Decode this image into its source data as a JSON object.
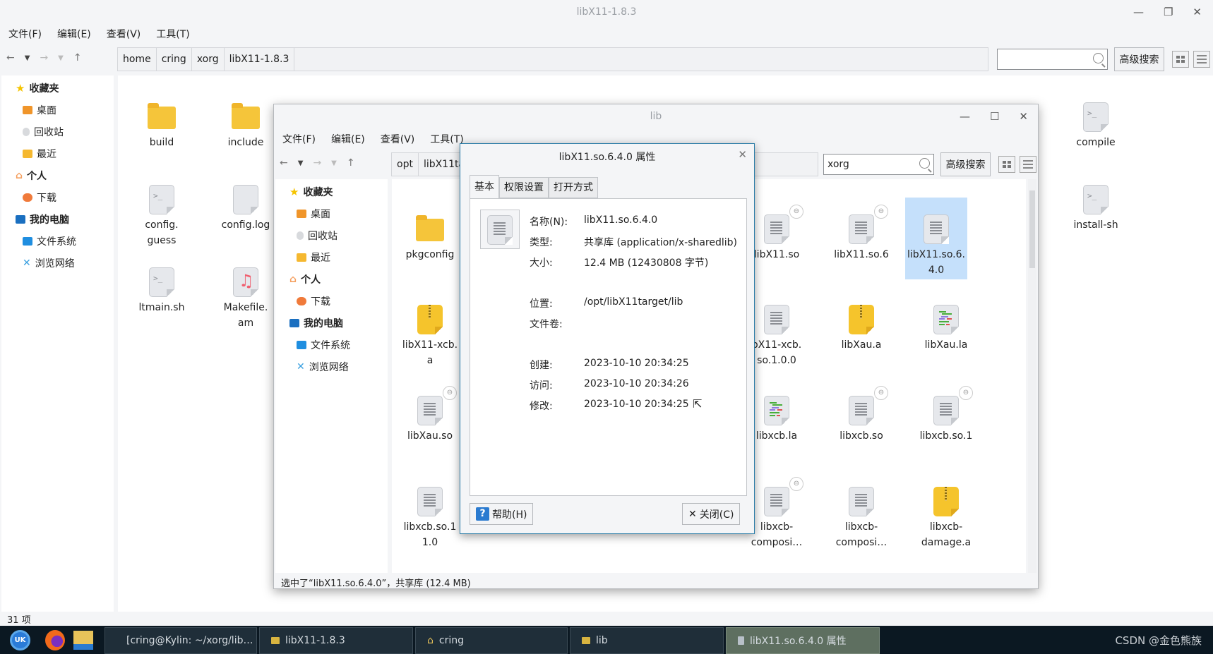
{
  "main_window": {
    "title": "libX11-1.8.3",
    "menu": [
      "文件(F)",
      "编辑(E)",
      "查看(V)",
      "工具(T)"
    ],
    "breadcrumbs": [
      "home",
      "cring",
      "xorg",
      "libX11-1.8.3"
    ],
    "search_value": "",
    "advanced_search_label": "高级搜索",
    "sidebar": [
      {
        "label": "收藏夹",
        "header": true,
        "icon": "star-icon"
      },
      {
        "label": "桌面",
        "icon": "desktop-icon"
      },
      {
        "label": "回收站",
        "icon": "trash-icon"
      },
      {
        "label": "最近",
        "icon": "recent-icon"
      },
      {
        "label": "个人",
        "header": true,
        "icon": "home-icon"
      },
      {
        "label": "下载",
        "icon": "download-icon"
      },
      {
        "label": "我的电脑",
        "header": true,
        "icon": "computer-icon"
      },
      {
        "label": "文件系统",
        "icon": "drive-icon"
      },
      {
        "label": "浏览网络",
        "icon": "network-icon"
      }
    ],
    "files": [
      {
        "name": "build",
        "type": "folder"
      },
      {
        "name": "include",
        "type": "folder"
      },
      {
        "name": "compile",
        "type": "script"
      },
      {
        "name": "config.\nguess",
        "type": "script"
      },
      {
        "name": "config.log",
        "type": "doc"
      },
      {
        "name": "install-sh",
        "type": "script"
      },
      {
        "name": "ltmain.sh",
        "type": "script"
      },
      {
        "name": "Makefile.\nam",
        "type": "music"
      }
    ],
    "status": "31 项"
  },
  "lib_window": {
    "title": "lib",
    "menu": [
      "文件(F)",
      "编辑(E)",
      "查看(V)",
      "工具(T)"
    ],
    "breadcrumbs": [
      "opt",
      "libX11ta"
    ],
    "search_value": "xorg",
    "advanced_search_label": "高级搜索",
    "sidebar": [
      {
        "label": "收藏夹",
        "header": true
      },
      {
        "label": "桌面"
      },
      {
        "label": "回收站"
      },
      {
        "label": "最近"
      },
      {
        "label": "个人",
        "header": true
      },
      {
        "label": "下载"
      },
      {
        "label": "我的电脑",
        "header": true
      },
      {
        "label": "文件系统"
      },
      {
        "label": "浏览网络"
      }
    ],
    "files": [
      {
        "name": "pkgconfig",
        "type": "folder"
      },
      {
        "name": "libX11.so",
        "type": "doc",
        "link": true
      },
      {
        "name": "libX11.so.6",
        "type": "doc",
        "link": true
      },
      {
        "name": "libX11.so.6.\n4.0",
        "type": "doc",
        "selected": true
      },
      {
        "name": "libX11-xcb.\na",
        "type": "zip"
      },
      {
        "name": "bX11-xcb.\nso.1.0.0",
        "type": "doc"
      },
      {
        "name": "libXau.a",
        "type": "zip"
      },
      {
        "name": "libXau.la",
        "type": "code"
      },
      {
        "name": "libXau.so",
        "type": "doc",
        "link": true
      },
      {
        "name": "libxcb.la",
        "type": "code"
      },
      {
        "name": "libxcb.so",
        "type": "doc",
        "link": true
      },
      {
        "name": "libxcb.so.1",
        "type": "doc",
        "link": true
      },
      {
        "name": "libxcb.so.1\n1.0",
        "type": "doc"
      },
      {
        "name": "composi…",
        "type": "hidden"
      },
      {
        "name": "composi…",
        "type": "hidden"
      },
      {
        "name": "composi…",
        "type": "hidden"
      },
      {
        "name": "libxcb-\ncomposi…",
        "type": "doc",
        "link": true
      },
      {
        "name": "libxcb-\ncomposi…",
        "type": "doc"
      },
      {
        "name": "libxcb-\ndamage.a",
        "type": "zip"
      }
    ],
    "status": "选中了“libX11.so.6.4.0”，共享库 (12.4 MB)"
  },
  "dialog": {
    "title": "libX11.so.6.4.0 属性",
    "tabs": [
      "基本",
      "权限设置",
      "打开方式"
    ],
    "rows": [
      {
        "label": "名称(N):",
        "value": "libX11.so.6.4.0"
      },
      {
        "label": "类型:",
        "value": "共享库 (application/x-sharedlib)"
      },
      {
        "label": "大小:",
        "value": "12.4 MB (12430808 字节)"
      },
      {
        "label": "位置:",
        "value": "/opt/libX11target/lib"
      },
      {
        "label": "文件卷:",
        "value": ""
      },
      {
        "label": "创建:",
        "value": "2023-10-10 20:34:25"
      },
      {
        "label": "访问:",
        "value": "2023-10-10 20:34:26"
      },
      {
        "label": "修改:",
        "value": "2023-10-10 20:34:25"
      }
    ],
    "help_label": "帮助(H)",
    "close_label": "关闭(C)"
  },
  "taskbar": {
    "tasks": [
      {
        "label": "[cring@Kylin: ~/xorg/lib…",
        "icon": "terminal"
      },
      {
        "label": "libX11-1.8.3",
        "icon": "folder"
      },
      {
        "label": "cring",
        "icon": "home"
      },
      {
        "label": "lib",
        "icon": "folder"
      },
      {
        "label": "libX11.so.6.4.0 属性",
        "icon": "doc",
        "active": true
      }
    ],
    "watermark": "CSDN @金色熊族"
  }
}
